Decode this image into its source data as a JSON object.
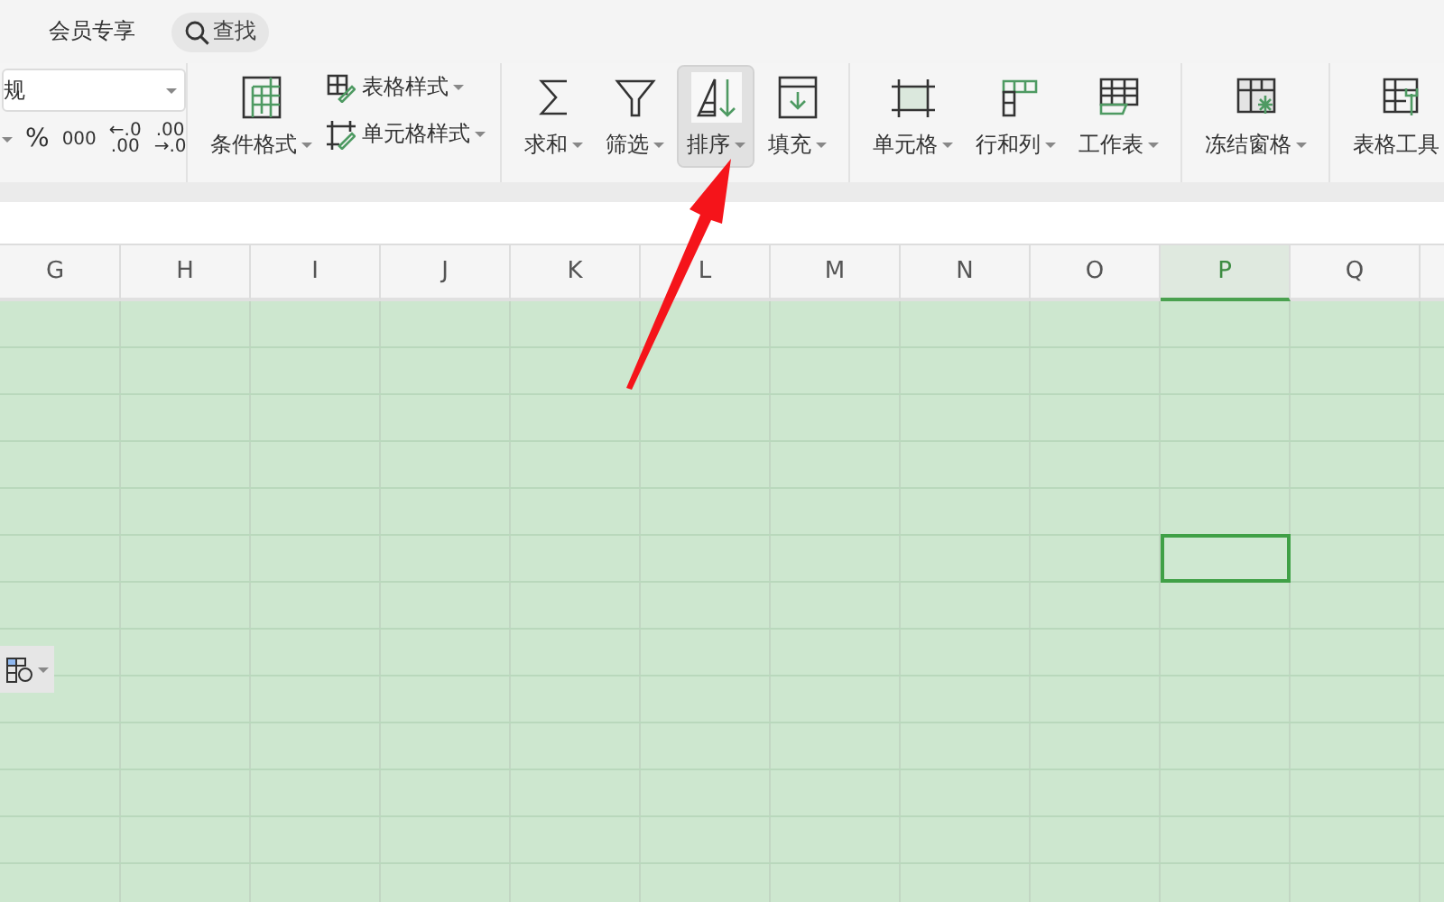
{
  "top_bar": {
    "tabs": [
      {
        "label": "会员专享"
      }
    ],
    "search": {
      "label": "查找"
    }
  },
  "ribbon": {
    "number_format": {
      "value": "规"
    },
    "number_buttons": [
      {
        "label": "%"
      },
      {
        "label": "000"
      },
      {
        "label": "←.0 .00"
      },
      {
        "label": ".00 →.0"
      }
    ],
    "groups": [
      [
        {
          "kind": "large",
          "label": "条件格式",
          "selected": false
        },
        {
          "kind": "stack",
          "items": [
            {
              "label": "表格样式",
              "selected": false
            },
            {
              "label": "单元格样式",
              "selected": false
            }
          ]
        }
      ],
      [
        {
          "kind": "large",
          "label": "求和",
          "selected": false
        },
        {
          "kind": "large",
          "label": "筛选",
          "selected": false
        },
        {
          "kind": "large",
          "label": "排序",
          "selected": true
        },
        {
          "kind": "large",
          "label": "填充",
          "selected": false
        }
      ],
      [
        {
          "kind": "large",
          "label": "单元格",
          "selected": false
        },
        {
          "kind": "large",
          "label": "行和列",
          "selected": false
        },
        {
          "kind": "large",
          "label": "工作表",
          "selected": false
        }
      ],
      [
        {
          "kind": "large",
          "label": "冻结窗格",
          "selected": false
        }
      ],
      [
        {
          "kind": "large",
          "label": "表格工具",
          "selected": false
        }
      ]
    ]
  },
  "columns": [
    {
      "label": "G",
      "selected": false
    },
    {
      "label": "H",
      "selected": false
    },
    {
      "label": "I",
      "selected": false
    },
    {
      "label": "J",
      "selected": false
    },
    {
      "label": "K",
      "selected": false
    },
    {
      "label": "L",
      "selected": false
    },
    {
      "label": "M",
      "selected": false
    },
    {
      "label": "N",
      "selected": false
    },
    {
      "label": "O",
      "selected": false
    },
    {
      "label": "P",
      "selected": true
    },
    {
      "label": "Q",
      "selected": false
    },
    {
      "selected": false
    }
  ],
  "rows": [
    {
      "selected": false
    },
    {
      "selected": false
    },
    {
      "selected": false
    },
    {
      "selected": false
    },
    {
      "selected": false
    },
    {
      "selected": true
    },
    {
      "selected": false
    },
    {
      "selected": false
    },
    {
      "selected": false
    },
    {
      "selected": false
    },
    {
      "selected": false
    },
    {
      "selected": false
    },
    {
      "selected": false
    }
  ]
}
